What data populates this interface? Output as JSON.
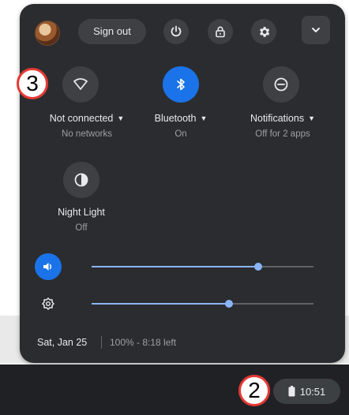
{
  "header": {
    "sign_out_label": "Sign out",
    "icons": [
      "avatar",
      "power-icon",
      "lock-icon",
      "gear-icon",
      "chevron-down-icon"
    ]
  },
  "tiles": {
    "network": {
      "label": "Not connected",
      "sublabel": "No networks",
      "icon": "wifi-off-icon",
      "active": false
    },
    "bluetooth": {
      "label": "Bluetooth",
      "sublabel": "On",
      "icon": "bluetooth-icon",
      "active": true
    },
    "notifications": {
      "label": "Notifications",
      "sublabel": "Off for 2 apps",
      "icon": "do-not-disturb-icon",
      "active": false
    },
    "night_light": {
      "label": "Night Light",
      "sublabel": "Off",
      "icon": "night-light-icon",
      "active": false
    }
  },
  "sliders": {
    "volume": {
      "icon": "volume-icon",
      "level": 0.75
    },
    "brightness": {
      "icon": "brightness-icon",
      "level": 0.62
    }
  },
  "footer": {
    "date": "Sat, Jan 25",
    "battery": "100% - 8:18 left"
  },
  "shelf": {
    "time": "10:51",
    "icon": "battery-icon"
  },
  "callouts": {
    "step_three": "3",
    "step_two": "2"
  },
  "colors": {
    "panel": "#2b2c2f",
    "accent": "#1a73e8",
    "slider": "#8ab4f8",
    "callout_border": "#e53935"
  }
}
